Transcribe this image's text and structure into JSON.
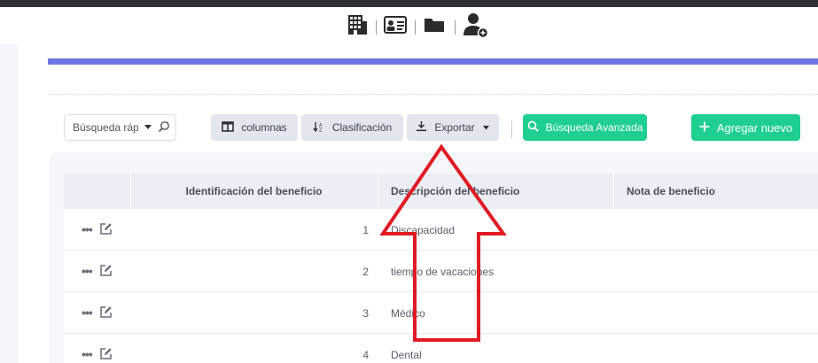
{
  "top_icons": [
    "building-icon",
    "id-card-icon",
    "folder-icon",
    "add-user-icon"
  ],
  "toolbar": {
    "quick_search_placeholder": "Búsqueda rápida",
    "columns_label": "columnas",
    "sort_label": "Clasificación",
    "export_label": "Exportar",
    "advanced_search_label": "Búsqueda Avanzada",
    "add_new_label": "Agregar nuevo"
  },
  "table": {
    "headers": [
      "",
      "Identificación del beneficio",
      "Descripción del beneficio",
      "Nota de beneficio"
    ],
    "rows": [
      {
        "id": "1",
        "description": "Discapacidad",
        "note": ""
      },
      {
        "id": "2",
        "description": "tiempo de vacaciones",
        "note": ""
      },
      {
        "id": "3",
        "description": "Médico",
        "note": ""
      },
      {
        "id": "4",
        "description": "Dental",
        "note": ""
      }
    ]
  },
  "colors": {
    "accent": "#6f75e3",
    "primary_green": "#1fcf8f",
    "annotation_arrow": "#e01b24"
  }
}
